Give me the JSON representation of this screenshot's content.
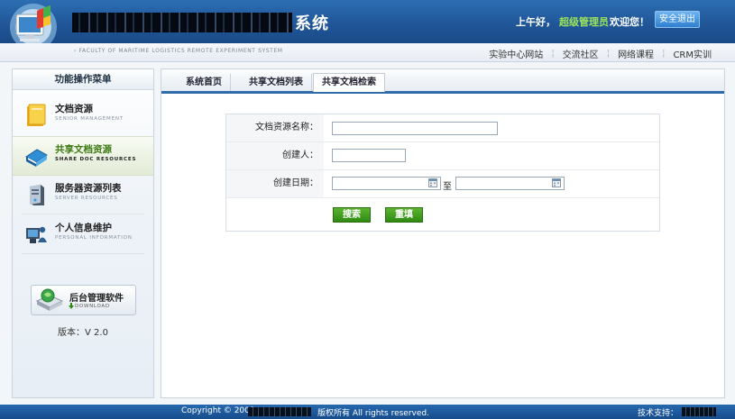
{
  "header": {
    "title_suffix": "系统",
    "greeting": "上午好，",
    "user": "超级管理员",
    "welcome": "欢迎您！",
    "logout_label": "安全退出",
    "faculty_line": "› FACULTY OF MARITIME LOGISTICS REMOTE EXPERIMENT SYSTEM",
    "links": [
      "实验中心网站",
      "交流社区",
      "网络课程",
      "CRM实训"
    ]
  },
  "sidebar": {
    "heading": "功能操作菜单",
    "items": [
      {
        "label": "文档资源",
        "sub": "SENIOR MANAGEMENT",
        "icon": "folder-icon"
      },
      {
        "label": "共享文档资源",
        "sub": "SHARE DOC RESOURCES",
        "icon": "books-icon"
      },
      {
        "label": "服务器资源列表",
        "sub": "SERVER RESOURCES",
        "icon": "server-icon"
      },
      {
        "label": "个人信息维护",
        "sub": "PERSONAL INFORMATION",
        "icon": "computer-user-icon"
      }
    ],
    "active_index": 1,
    "download": {
      "title": "后台管理软件",
      "sub": "DOWNLOAD"
    },
    "version": "版本：V 2.0"
  },
  "tabs": [
    "系统首页",
    "共享文档列表",
    "共享文档检索"
  ],
  "active_tab": 2,
  "search_form": {
    "name_label": "文档资源名称：",
    "name_value": "",
    "creator_label": "创建人：",
    "creator_value": "",
    "date_label": "创建日期：",
    "date_from": "",
    "date_to": "",
    "date_sep": "至",
    "search_button": "搜索",
    "reset_button": "重填"
  },
  "footer": {
    "copyright_prefix": "Copyright © 2009",
    "copyright_suffix": "版权所有  All rights reserved.",
    "support": "技术支持："
  }
}
